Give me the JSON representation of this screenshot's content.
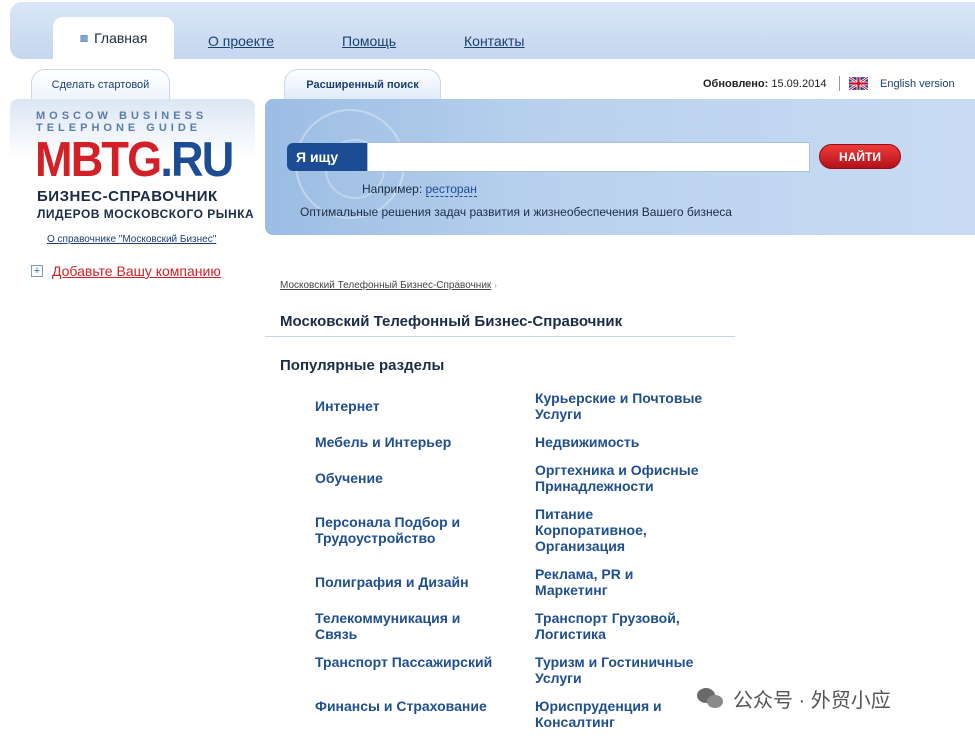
{
  "nav": {
    "home": "Главная",
    "about": "О проекте",
    "help": "Помощь",
    "contacts": "Контакты"
  },
  "tabs": {
    "make_start": "Сделать стартовой",
    "advanced_search": "Расширенный поиск"
  },
  "status": {
    "updated_label": "Обновлено:",
    "updated_date": "15.09.2014",
    "english": "English version"
  },
  "logo": {
    "line1": "MOSCOW BUSINESS",
    "line2": "TELEPHONE GUIDE",
    "main_red": "MBTG",
    "main_blue": ".RU",
    "sub1": "БИЗНЕС-СПРАВОЧНИК",
    "sub2": "ЛИДЕРОВ МОСКОВСКОГО РЫНКА",
    "about_link": "О справочнике \"Московский Бизнес\""
  },
  "sidebar": {
    "add_company": "Добавьте Вашу компанию"
  },
  "search": {
    "label": "Я ищу",
    "value": "",
    "button": "НАЙТИ",
    "example_prefix": "Например:",
    "example_link": "ресторан",
    "slogan": "Оптимальные решения задач развития и жизнеобеспечения Вашего бизнеса"
  },
  "main": {
    "breadcrumb": "Московский Телефонный Бизнес-Справочник",
    "title": "Московский Телефонный Бизнес-Справочник",
    "section": "Популярные разделы",
    "categories_left": [
      "Интернет",
      "Мебель и Интерьер",
      "Обучение",
      "Персонала Подбор и Трудоустройство",
      "Полиграфия и Дизайн",
      "Телекоммуникация и Связь",
      "Транспорт Пассажирский",
      "Финансы и Страхование"
    ],
    "categories_right": [
      "Курьерские и Почтовые Услуги",
      "Недвижимость",
      "Оргтехника и Офисные Принадлежности",
      "Питание Корпоративное, Организация",
      "Реклама, PR и Маркетинг",
      "Транспорт Грузовой, Логистика",
      "Туризм и Гостиничные Услуги",
      "Юриспруденция и Консалтинг"
    ]
  },
  "watermark": "公众号 · 外贸小应"
}
